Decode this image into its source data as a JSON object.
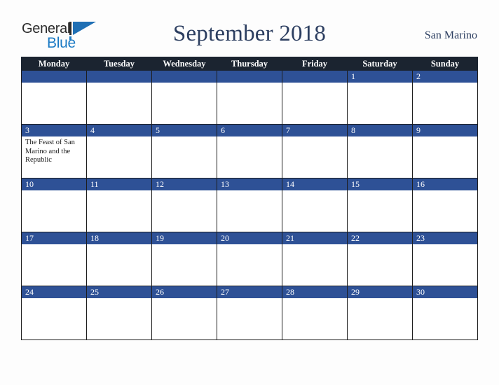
{
  "brand": {
    "word_one": "General",
    "word_two": "Blue",
    "mark_icon": "blue-triangle-logo-icon",
    "color_dark": "#2b2b2b",
    "color_blue": "#1b7ac4"
  },
  "header": {
    "title": "September 2018",
    "location": "San Marino",
    "title_color": "#2c3e60"
  },
  "calendar": {
    "month": "September",
    "year": "2018",
    "weekday_headers": [
      "Monday",
      "Tuesday",
      "Wednesday",
      "Thursday",
      "Friday",
      "Saturday",
      "Sunday"
    ],
    "header_bg": "#1b2430",
    "date_bar_bg": "#2e5196",
    "cell_bg": "#ffffff",
    "weeks": [
      [
        {
          "date": "",
          "event": ""
        },
        {
          "date": "",
          "event": ""
        },
        {
          "date": "",
          "event": ""
        },
        {
          "date": "",
          "event": ""
        },
        {
          "date": "",
          "event": ""
        },
        {
          "date": "1",
          "event": ""
        },
        {
          "date": "2",
          "event": ""
        }
      ],
      [
        {
          "date": "3",
          "event": "The Feast of San Marino and the Republic"
        },
        {
          "date": "4",
          "event": ""
        },
        {
          "date": "5",
          "event": ""
        },
        {
          "date": "6",
          "event": ""
        },
        {
          "date": "7",
          "event": ""
        },
        {
          "date": "8",
          "event": ""
        },
        {
          "date": "9",
          "event": ""
        }
      ],
      [
        {
          "date": "10",
          "event": ""
        },
        {
          "date": "11",
          "event": ""
        },
        {
          "date": "12",
          "event": ""
        },
        {
          "date": "13",
          "event": ""
        },
        {
          "date": "14",
          "event": ""
        },
        {
          "date": "15",
          "event": ""
        },
        {
          "date": "16",
          "event": ""
        }
      ],
      [
        {
          "date": "17",
          "event": ""
        },
        {
          "date": "18",
          "event": ""
        },
        {
          "date": "19",
          "event": ""
        },
        {
          "date": "20",
          "event": ""
        },
        {
          "date": "21",
          "event": ""
        },
        {
          "date": "22",
          "event": ""
        },
        {
          "date": "23",
          "event": ""
        }
      ],
      [
        {
          "date": "24",
          "event": ""
        },
        {
          "date": "25",
          "event": ""
        },
        {
          "date": "26",
          "event": ""
        },
        {
          "date": "27",
          "event": ""
        },
        {
          "date": "28",
          "event": ""
        },
        {
          "date": "29",
          "event": ""
        },
        {
          "date": "30",
          "event": ""
        }
      ]
    ]
  }
}
